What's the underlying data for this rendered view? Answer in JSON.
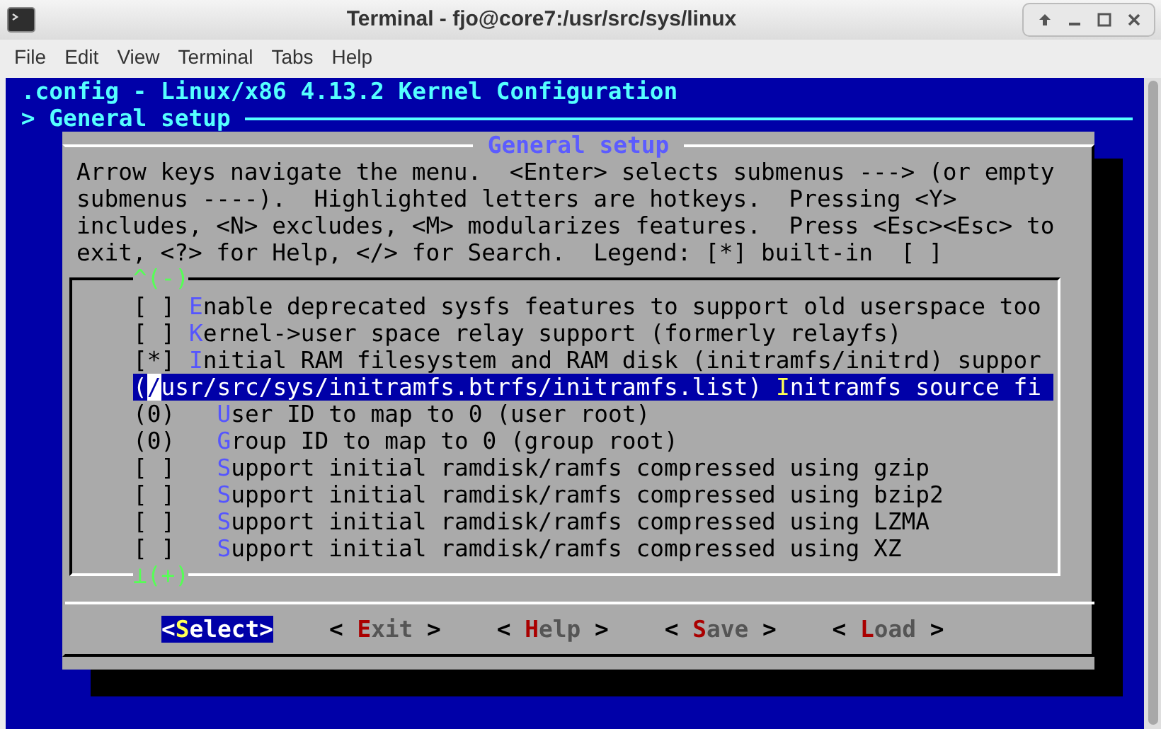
{
  "window": {
    "title": "Terminal - fjo@core7:/usr/src/sys/linux"
  },
  "menu": [
    "File",
    "Edit",
    "View",
    "Terminal",
    "Tabs",
    "Help"
  ],
  "terminal": {
    "header": ".config - Linux/x86 4.13.2 Kernel Configuration",
    "breadcrumb": "> General setup",
    "dialog": {
      "title": "General setup",
      "help_lines": [
        "Arrow keys navigate the menu.  <Enter> selects submenus ---> (or empty",
        "submenus ----).  Highlighted letters are hotkeys.  Pressing <Y>",
        "includes, <N> excludes, <M> modularizes features.  Press <Esc><Esc> to",
        "exit, <?> for Help, </> for Search.  Legend: [*] built-in  [ ]"
      ],
      "scroll_up": "^(-)",
      "scroll_down": "⊥(+)",
      "items": [
        {
          "marker": "[ ]",
          "hotkey": "E",
          "label": "nable deprecated sysfs features to support old userspace too",
          "selected": false
        },
        {
          "marker": "[ ]",
          "hotkey": "K",
          "label": "ernel->user space relay support (formerly relayfs)",
          "selected": false
        },
        {
          "marker": "[*]",
          "hotkey": "I",
          "label": "nitial RAM filesystem and RAM disk (initramfs/initrd) suppor",
          "selected": false,
          "children": [
            {
              "marker": "(/usr/src/sys/initramfs.btrfs/initramfs.list)",
              "hotkey": "I",
              "label": "nitramfs source fi",
              "selected": true,
              "cursor": true
            },
            {
              "marker": "(0)",
              "hotkey": "U",
              "label": "ser ID to map to 0 (user root)",
              "selected": false
            },
            {
              "marker": "(0)",
              "hotkey": "G",
              "label": "roup ID to map to 0 (group root)",
              "selected": false
            },
            {
              "marker": "[ ]",
              "hotkey": "S",
              "label": "upport initial ramdisk/ramfs compressed using gzip",
              "selected": false
            },
            {
              "marker": "[ ]",
              "hotkey": "S",
              "label": "upport initial ramdisk/ramfs compressed using bzip2",
              "selected": false
            },
            {
              "marker": "[ ]",
              "hotkey": "S",
              "label": "upport initial ramdisk/ramfs compressed using LZMA",
              "selected": false
            },
            {
              "marker": "[ ]",
              "hotkey": "S",
              "label": "upport initial ramdisk/ramfs compressed using XZ",
              "selected": false
            }
          ]
        }
      ],
      "buttons": [
        {
          "left": "<",
          "hotkey": "S",
          "rest": "elect",
          "right": ">",
          "selected": true
        },
        {
          "left": "< ",
          "hotkey": "E",
          "rest": "xit",
          "right": " >",
          "selected": false
        },
        {
          "left": "< ",
          "hotkey": "H",
          "rest": "elp",
          "right": " >",
          "selected": false
        },
        {
          "left": "< ",
          "hotkey": "S",
          "rest": "ave",
          "right": " >",
          "selected": false
        },
        {
          "left": "< ",
          "hotkey": "L",
          "rest": "oad",
          "right": " >",
          "selected": false
        }
      ]
    }
  }
}
